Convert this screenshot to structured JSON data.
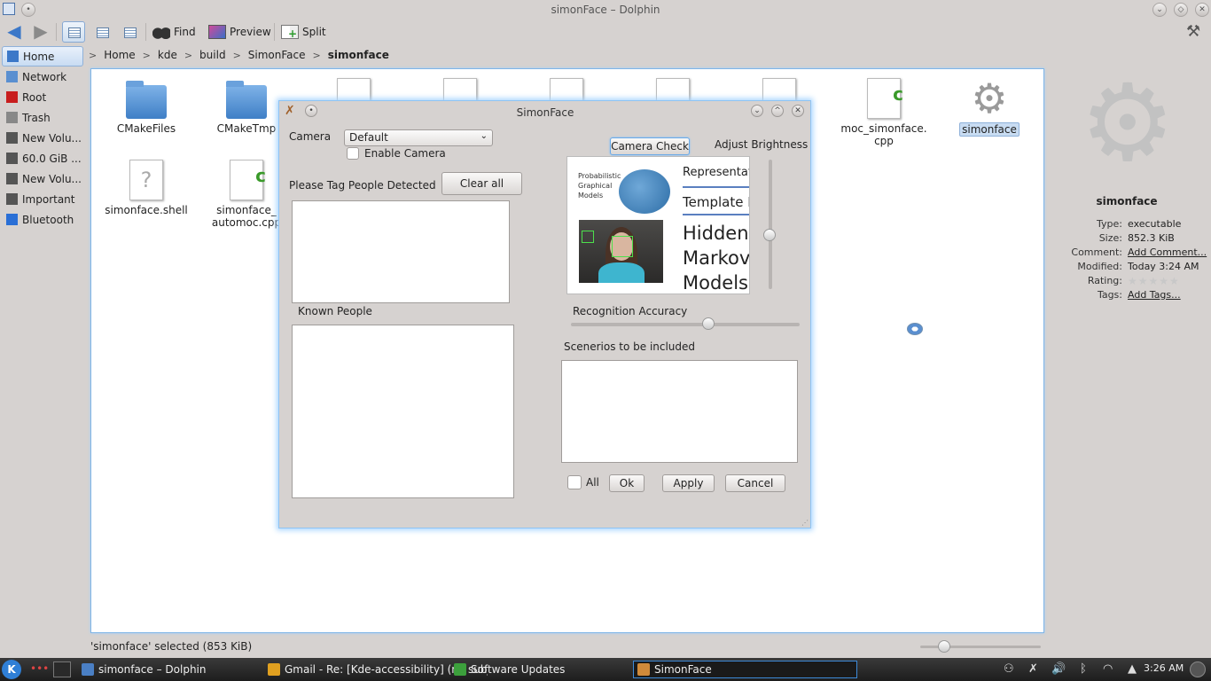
{
  "window": {
    "title": "simonFace – Dolphin"
  },
  "toolbar": {
    "find_label": "Find",
    "preview_label": "Preview",
    "split_label": "Split"
  },
  "places": [
    {
      "label": "Home",
      "icon": "home-icon",
      "color": "#3c78c8"
    },
    {
      "label": "Network",
      "icon": "network-icon",
      "color": "#5a8fd0"
    },
    {
      "label": "Root",
      "icon": "root-folder-icon",
      "color": "#c81e1e"
    },
    {
      "label": "Trash",
      "icon": "trash-icon",
      "color": "#888888"
    },
    {
      "label": "New Volu...",
      "icon": "drive-icon",
      "color": "#555555"
    },
    {
      "label": "60.0 GiB ...",
      "icon": "drive-icon",
      "color": "#555555"
    },
    {
      "label": "New Volu...",
      "icon": "drive-icon",
      "color": "#555555"
    },
    {
      "label": "Important",
      "icon": "drive-icon",
      "color": "#555555"
    },
    {
      "label": "Bluetooth",
      "icon": "bluetooth-icon",
      "color": "#2a6fd6"
    }
  ],
  "breadcrumb": [
    "Home",
    "kde",
    "build",
    "SimonFace",
    "simonface"
  ],
  "files": {
    "cmakefiles": "CMakeFiles",
    "cmaketmp": "CMakeTmp",
    "moc": "moc_simonface.\ncpp",
    "simonface": "simonface",
    "shell": "simonface.shell",
    "automoc": "simonface_\nautomoc.cpp"
  },
  "statusbar": {
    "text": "'simonface' selected (853 KiB)"
  },
  "info": {
    "name": "simonface",
    "type_label": "Type:",
    "type": "executable",
    "size_label": "Size:",
    "size": "852.3 KiB",
    "comment_label": "Comment:",
    "comment": "Add Comment...",
    "modified_label": "Modified:",
    "modified": "Today 3:24 AM",
    "rating_label": "Rating:",
    "rating": 0,
    "tags_label": "Tags:",
    "tags": "Add Tags..."
  },
  "dialog": {
    "title": "SimonFace",
    "camera_label": "Camera",
    "camera_value": "Default",
    "enable_camera_label": "Enable Camera",
    "tag_label": "Please Tag People Detected",
    "clear_all_label": "Clear all",
    "known_people_label": "Known People",
    "camera_check_label": "Camera Check",
    "adjust_brightness_label": "Adjust Brightness",
    "recognition_accuracy_label": "Recognition Accuracy",
    "scenarios_label": "Scenerios to be included",
    "all_label": "All",
    "ok_label": "Ok",
    "apply_label": "Apply",
    "cancel_label": "Cancel",
    "brightness_level": 0.42,
    "accuracy_level": 0.6,
    "slide": {
      "small_text": "Probabilistic\nGraphical\nModels",
      "line1": "Representati",
      "line2": "Template M",
      "line3": "Hidden",
      "line4": "Markov",
      "line5": "Models"
    }
  },
  "taskbar": {
    "tasks": [
      {
        "label": "simonface – Dolphin",
        "icon": "dolphin-icon",
        "color": "#4a7fc4"
      },
      {
        "label": "Gmail - Re: [Kde-accessibility] (no subject)",
        "icon": "chrome-icon",
        "color": "#e0a020"
      },
      {
        "label": "Software Updates",
        "icon": "updates-icon",
        "color": "#3ca03c"
      },
      {
        "label": "SimonFace",
        "icon": "simonface-icon",
        "color": "#d08a3a"
      }
    ],
    "clock": "3:26 AM"
  }
}
